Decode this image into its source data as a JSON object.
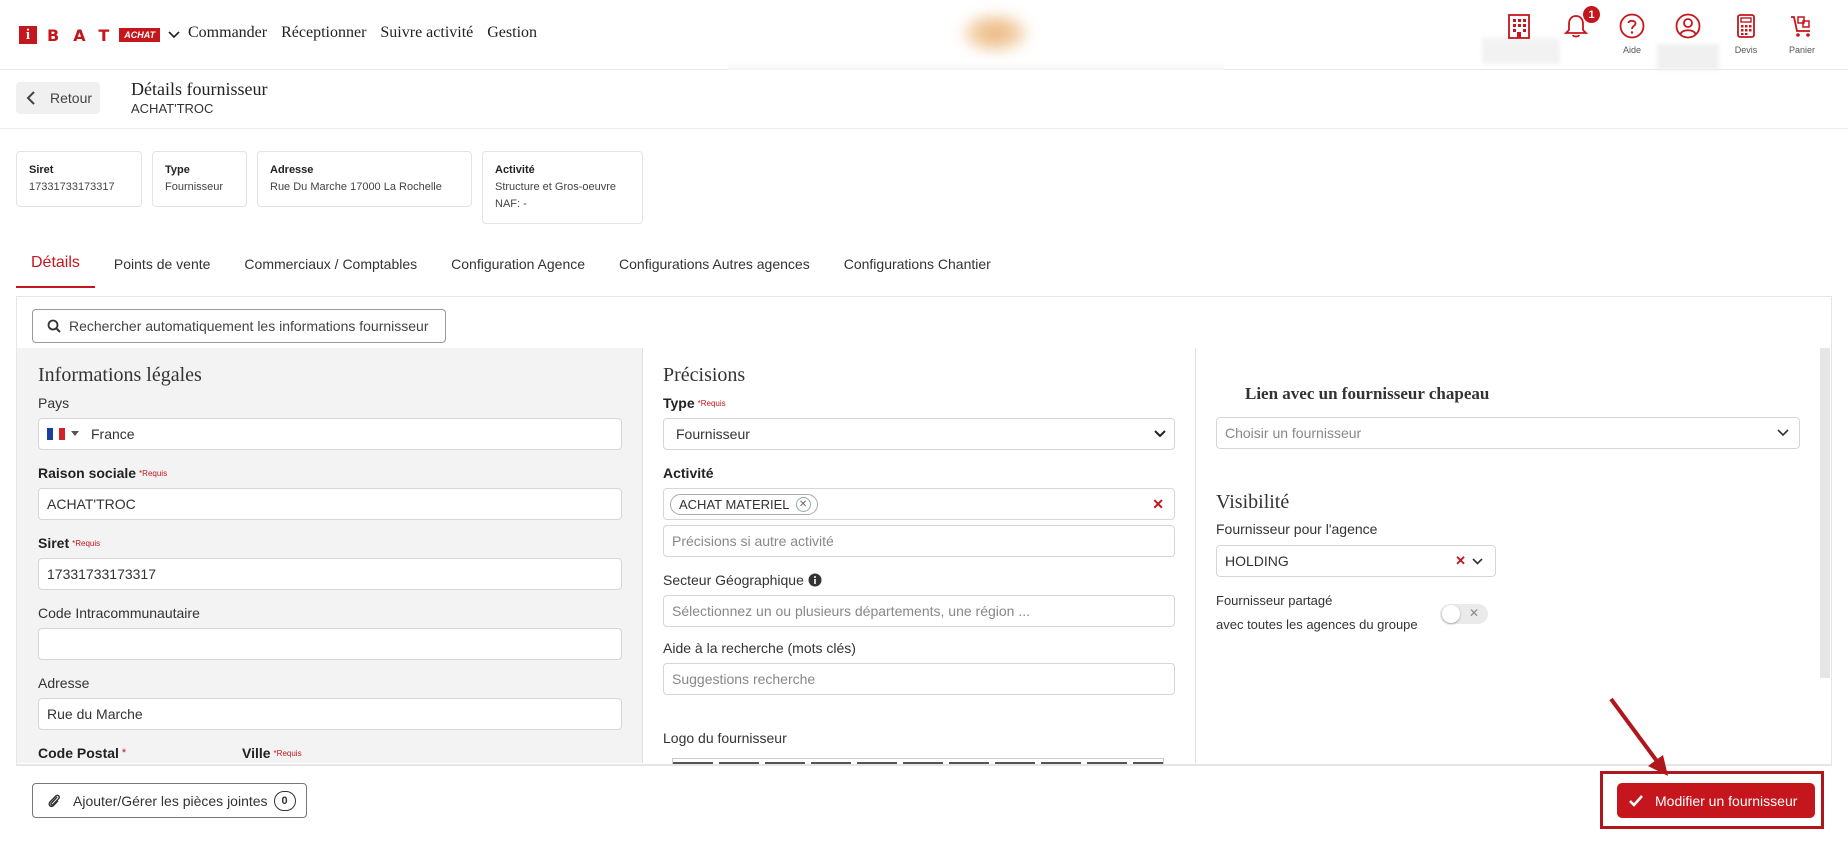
{
  "header": {
    "logo_letters": "BAT",
    "logo_tag": "ACHAT",
    "nav": [
      "Commander",
      "Réceptionner",
      "Suivre activité",
      "Gestion"
    ],
    "notifications_count": "1",
    "icon_labels": {
      "aide": "Aide",
      "devis": "Devis",
      "panier": "Panier"
    }
  },
  "page": {
    "back_label": "Retour",
    "title": "Détails fournisseur",
    "subtitle": "ACHAT'TROC"
  },
  "cards": [
    {
      "label": "Siret",
      "lines": [
        "17331733173317"
      ]
    },
    {
      "label": "Type",
      "lines": [
        "Fournisseur"
      ]
    },
    {
      "label": "Adresse",
      "lines": [
        "Rue Du Marche 17000 La Rochelle"
      ]
    },
    {
      "label": "Activité",
      "lines": [
        "Structure et Gros-oeuvre",
        "NAF: -"
      ]
    }
  ],
  "tabs": [
    "Détails",
    "Points de vente",
    "Commerciaux / Comptables",
    "Configuration Agence",
    "Configurations Autres agences",
    "Configurations Chantier"
  ],
  "search_button": "Rechercher automatiquement les informations fournisseur",
  "legal": {
    "title": "Informations légales",
    "pays_label": "Pays",
    "pays_value": "France",
    "raison_label": "Raison sociale",
    "raison_value": "ACHAT'TROC",
    "siret_label": "Siret",
    "siret_value": "17331733173317",
    "intra_label": "Code Intracommunautaire",
    "intra_value": "",
    "adresse_label": "Adresse",
    "adresse_value": "Rue du Marche",
    "cp_label": "Code Postal",
    "cp_req": "*",
    "ville_label": "Ville",
    "required": "*Requis"
  },
  "precisions": {
    "title": "Précisions",
    "type_label": "Type",
    "type_value": "Fournisseur",
    "activite_label": "Activité",
    "activite_chip": "ACHAT MATERIEL",
    "autre_placeholder": "Précisions si autre activité",
    "secteur_label": "Secteur Géographique",
    "secteur_placeholder": "Sélectionnez un ou plusieurs départements, une région ...",
    "aide_label": "Aide à la recherche (mots clés)",
    "aide_placeholder": "Suggestions recherche",
    "logo_label": "Logo du fournisseur"
  },
  "lien": {
    "title": "Lien avec un fournisseur chapeau",
    "placeholder": "Choisir un fournisseur"
  },
  "visibilite": {
    "title": "Visibilité",
    "agence_label": "Fournisseur pour l'agence",
    "agence_value": "HOLDING",
    "partage_line1": "Fournisseur partagé",
    "partage_line2": "avec toutes les agences du groupe",
    "toggle_on": false
  },
  "footer": {
    "attach_label": "Ajouter/Gérer les pièces jointes",
    "attach_count": "0",
    "submit_label": "Modifier un fournisseur"
  },
  "colors": {
    "brand": "#c4161c",
    "highlight": "#b0171d"
  },
  "icons": [
    "chevron-down-icon",
    "building-icon",
    "bell-icon",
    "help-icon",
    "user-icon",
    "calculator-icon",
    "cart-icon",
    "chevron-left-icon",
    "search-icon",
    "info-icon",
    "paperclip-icon",
    "check-icon",
    "arrow-annotation"
  ]
}
